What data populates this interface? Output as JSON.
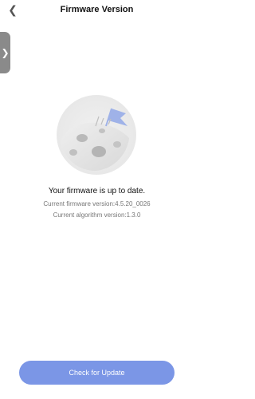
{
  "header": {
    "title": "Firmware Version"
  },
  "content": {
    "status_message": "Your firmware is up to date.",
    "firmware_version_text": "Current firmware version:4.5.20_0026",
    "algorithm_version_text": "Current algorithm version:1.3.0"
  },
  "footer": {
    "update_button_label": "Check for Update"
  },
  "colors": {
    "accent": "#7b96e6",
    "side_tab": "#8a8a8a"
  },
  "icons": {
    "back": "chevron-left-icon",
    "side_tab": "chevron-right-icon",
    "illustration": "moon-flag-illustration"
  }
}
